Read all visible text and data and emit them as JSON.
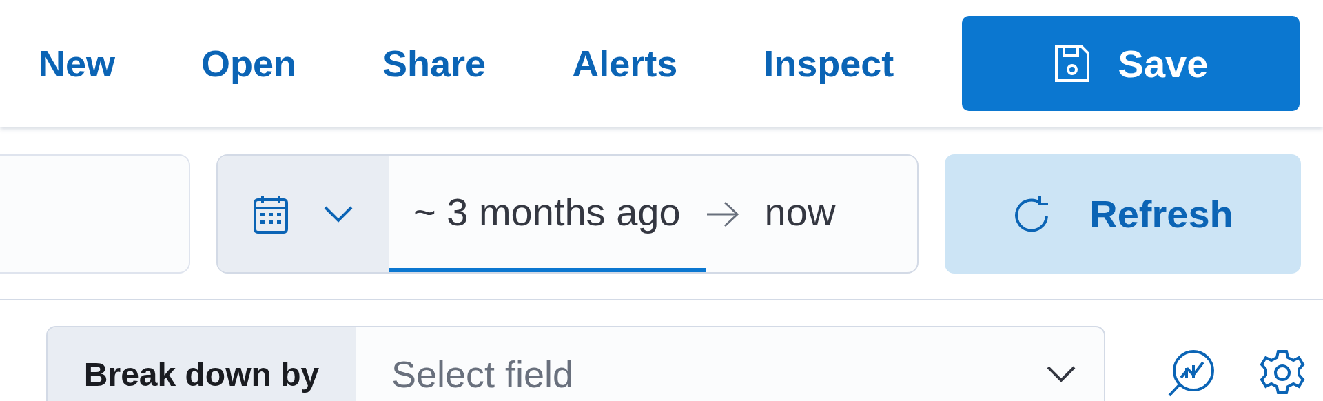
{
  "top_nav": {
    "links": [
      {
        "label": "New"
      },
      {
        "label": "Open"
      },
      {
        "label": "Share"
      },
      {
        "label": "Alerts"
      },
      {
        "label": "Inspect"
      }
    ],
    "save_button": {
      "label": "Save"
    }
  },
  "query_bar": {
    "date_range": {
      "start": {
        "label": "~ 3 months ago",
        "selected": true
      },
      "end": {
        "label": "now",
        "selected": false
      }
    },
    "refresh_button": {
      "label": "Refresh"
    }
  },
  "breakdown": {
    "label": "Break down by",
    "placeholder": "Select field"
  }
}
